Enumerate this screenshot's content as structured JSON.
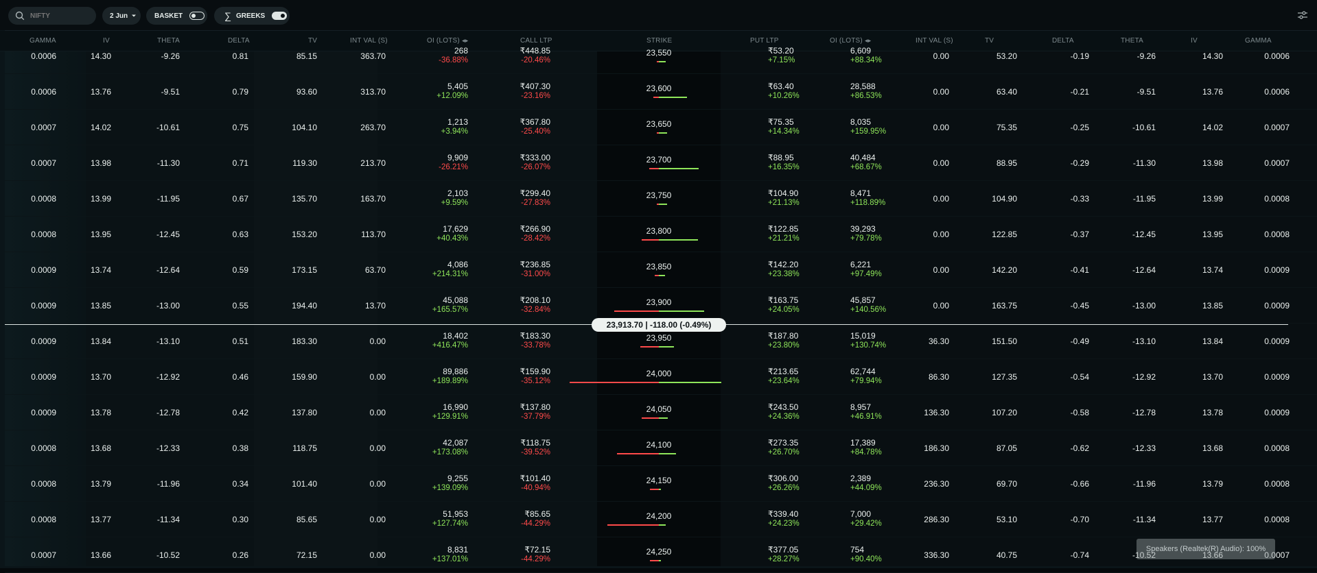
{
  "toolbar": {
    "search_placeholder": "NIFTY",
    "expiry": "2 Jun",
    "basket_label": "BASKET",
    "greeks_label": "GREEKS"
  },
  "headers": {
    "call": [
      "GAMMA",
      "IV",
      "THETA",
      "DELTA",
      "TV",
      "INT VAL (S)",
      "OI (LOTS)",
      "CALL LTP"
    ],
    "strike": "STRIKE",
    "put": [
      "PUT LTP",
      "OI (LOTS)",
      "INT VAL (S)",
      "TV",
      "DELTA",
      "THETA",
      "IV",
      "GAMMA"
    ]
  },
  "rows": [
    {
      "c_gamma": "0.0006",
      "c_iv": "14.30",
      "c_theta": "-9.26",
      "c_delta": "0.81",
      "c_tv": "85.15",
      "c_int": "363.70",
      "c_oi": "268",
      "c_oi_chg": "-36.88%",
      "c_ltp": "₹448.85",
      "c_ltp_chg": "-20.46%",
      "strike": "23,550",
      "p_ltp": "₹53.20",
      "p_ltp_chg": "+7.15%",
      "p_oi": "6,609",
      "p_oi_chg": "+88.34%",
      "p_int": "0.00",
      "p_tv": "53.20",
      "p_delta": "-0.19",
      "p_theta": "-9.26",
      "p_iv": "14.30",
      "p_gamma": "0.0006"
    },
    {
      "c_gamma": "0.0006",
      "c_iv": "13.76",
      "c_theta": "-9.51",
      "c_delta": "0.79",
      "c_tv": "93.60",
      "c_int": "313.70",
      "c_oi": "5,405",
      "c_oi_chg": "+12.09%",
      "c_ltp": "₹407.30",
      "c_ltp_chg": "-23.16%",
      "strike": "23,600",
      "p_ltp": "₹63.40",
      "p_ltp_chg": "+10.26%",
      "p_oi": "28,588",
      "p_oi_chg": "+86.53%",
      "p_int": "0.00",
      "p_tv": "63.40",
      "p_delta": "-0.21",
      "p_theta": "-9.51",
      "p_iv": "13.76",
      "p_gamma": "0.0006"
    },
    {
      "c_gamma": "0.0007",
      "c_iv": "14.02",
      "c_theta": "-10.61",
      "c_delta": "0.75",
      "c_tv": "104.10",
      "c_int": "263.70",
      "c_oi": "1,213",
      "c_oi_chg": "+3.94%",
      "c_ltp": "₹367.80",
      "c_ltp_chg": "-25.40%",
      "strike": "23,650",
      "p_ltp": "₹75.35",
      "p_ltp_chg": "+14.34%",
      "p_oi": "8,035",
      "p_oi_chg": "+159.95%",
      "p_int": "0.00",
      "p_tv": "75.35",
      "p_delta": "-0.25",
      "p_theta": "-10.61",
      "p_iv": "14.02",
      "p_gamma": "0.0007"
    },
    {
      "c_gamma": "0.0007",
      "c_iv": "13.98",
      "c_theta": "-11.30",
      "c_delta": "0.71",
      "c_tv": "119.30",
      "c_int": "213.70",
      "c_oi": "9,909",
      "c_oi_chg": "-26.21%",
      "c_ltp": "₹333.00",
      "c_ltp_chg": "-26.07%",
      "strike": "23,700",
      "p_ltp": "₹88.95",
      "p_ltp_chg": "+16.35%",
      "p_oi": "40,484",
      "p_oi_chg": "+68.67%",
      "p_int": "0.00",
      "p_tv": "88.95",
      "p_delta": "-0.29",
      "p_theta": "-11.30",
      "p_iv": "13.98",
      "p_gamma": "0.0007"
    },
    {
      "c_gamma": "0.0008",
      "c_iv": "13.99",
      "c_theta": "-11.95",
      "c_delta": "0.67",
      "c_tv": "135.70",
      "c_int": "163.70",
      "c_oi": "2,103",
      "c_oi_chg": "+9.59%",
      "c_ltp": "₹299.40",
      "c_ltp_chg": "-27.83%",
      "strike": "23,750",
      "p_ltp": "₹104.90",
      "p_ltp_chg": "+21.13%",
      "p_oi": "8,471",
      "p_oi_chg": "+118.89%",
      "p_int": "0.00",
      "p_tv": "104.90",
      "p_delta": "-0.33",
      "p_theta": "-11.95",
      "p_iv": "13.99",
      "p_gamma": "0.0008"
    },
    {
      "c_gamma": "0.0008",
      "c_iv": "13.95",
      "c_theta": "-12.45",
      "c_delta": "0.63",
      "c_tv": "153.20",
      "c_int": "113.70",
      "c_oi": "17,629",
      "c_oi_chg": "+40.43%",
      "c_ltp": "₹266.90",
      "c_ltp_chg": "-28.42%",
      "strike": "23,800",
      "p_ltp": "₹122.85",
      "p_ltp_chg": "+21.21%",
      "p_oi": "39,293",
      "p_oi_chg": "+79.78%",
      "p_int": "0.00",
      "p_tv": "122.85",
      "p_delta": "-0.37",
      "p_theta": "-12.45",
      "p_iv": "13.95",
      "p_gamma": "0.0008"
    },
    {
      "c_gamma": "0.0009",
      "c_iv": "13.74",
      "c_theta": "-12.64",
      "c_delta": "0.59",
      "c_tv": "173.15",
      "c_int": "63.70",
      "c_oi": "4,086",
      "c_oi_chg": "+214.31%",
      "c_ltp": "₹236.85",
      "c_ltp_chg": "-31.00%",
      "strike": "23,850",
      "p_ltp": "₹142.20",
      "p_ltp_chg": "+23.38%",
      "p_oi": "6,221",
      "p_oi_chg": "+97.49%",
      "p_int": "0.00",
      "p_tv": "142.20",
      "p_delta": "-0.41",
      "p_theta": "-12.64",
      "p_iv": "13.74",
      "p_gamma": "0.0009"
    },
    {
      "c_gamma": "0.0009",
      "c_iv": "13.85",
      "c_theta": "-13.00",
      "c_delta": "0.55",
      "c_tv": "194.40",
      "c_int": "13.70",
      "c_oi": "45,088",
      "c_oi_chg": "+165.57%",
      "c_ltp": "₹208.10",
      "c_ltp_chg": "-32.84%",
      "strike": "23,900",
      "p_ltp": "₹163.75",
      "p_ltp_chg": "+24.05%",
      "p_oi": "45,857",
      "p_oi_chg": "+140.56%",
      "p_int": "0.00",
      "p_tv": "163.75",
      "p_delta": "-0.45",
      "p_theta": "-13.00",
      "p_iv": "13.85",
      "p_gamma": "0.0009"
    },
    {
      "c_gamma": "0.0009",
      "c_iv": "13.84",
      "c_theta": "-13.10",
      "c_delta": "0.51",
      "c_tv": "183.30",
      "c_int": "0.00",
      "c_oi": "18,402",
      "c_oi_chg": "+416.47%",
      "c_ltp": "₹183.30",
      "c_ltp_chg": "-33.78%",
      "strike": "23,950",
      "p_ltp": "₹187.80",
      "p_ltp_chg": "+23.80%",
      "p_oi": "15,019",
      "p_oi_chg": "+130.74%",
      "p_int": "36.30",
      "p_tv": "151.50",
      "p_delta": "-0.49",
      "p_theta": "-13.10",
      "p_iv": "13.84",
      "p_gamma": "0.0009"
    },
    {
      "c_gamma": "0.0009",
      "c_iv": "13.70",
      "c_theta": "-12.92",
      "c_delta": "0.46",
      "c_tv": "159.90",
      "c_int": "0.00",
      "c_oi": "89,886",
      "c_oi_chg": "+189.89%",
      "c_ltp": "₹159.90",
      "c_ltp_chg": "-35.12%",
      "strike": "24,000",
      "p_ltp": "₹213.65",
      "p_ltp_chg": "+23.64%",
      "p_oi": "62,744",
      "p_oi_chg": "+79.94%",
      "p_int": "86.30",
      "p_tv": "127.35",
      "p_delta": "-0.54",
      "p_theta": "-12.92",
      "p_iv": "13.70",
      "p_gamma": "0.0009"
    },
    {
      "c_gamma": "0.0009",
      "c_iv": "13.78",
      "c_theta": "-12.78",
      "c_delta": "0.42",
      "c_tv": "137.80",
      "c_int": "0.00",
      "c_oi": "16,990",
      "c_oi_chg": "+129.91%",
      "c_ltp": "₹137.80",
      "c_ltp_chg": "-37.79%",
      "strike": "24,050",
      "p_ltp": "₹243.50",
      "p_ltp_chg": "+24.36%",
      "p_oi": "8,957",
      "p_oi_chg": "+46.91%",
      "p_int": "136.30",
      "p_tv": "107.20",
      "p_delta": "-0.58",
      "p_theta": "-12.78",
      "p_iv": "13.78",
      "p_gamma": "0.0009"
    },
    {
      "c_gamma": "0.0008",
      "c_iv": "13.68",
      "c_theta": "-12.33",
      "c_delta": "0.38",
      "c_tv": "118.75",
      "c_int": "0.00",
      "c_oi": "42,087",
      "c_oi_chg": "+173.08%",
      "c_ltp": "₹118.75",
      "c_ltp_chg": "-39.52%",
      "strike": "24,100",
      "p_ltp": "₹273.35",
      "p_ltp_chg": "+26.70%",
      "p_oi": "17,389",
      "p_oi_chg": "+84.78%",
      "p_int": "186.30",
      "p_tv": "87.05",
      "p_delta": "-0.62",
      "p_theta": "-12.33",
      "p_iv": "13.68",
      "p_gamma": "0.0008"
    },
    {
      "c_gamma": "0.0008",
      "c_iv": "13.79",
      "c_theta": "-11.96",
      "c_delta": "0.34",
      "c_tv": "101.40",
      "c_int": "0.00",
      "c_oi": "9,255",
      "c_oi_chg": "+139.09%",
      "c_ltp": "₹101.40",
      "c_ltp_chg": "-40.94%",
      "strike": "24,150",
      "p_ltp": "₹306.00",
      "p_ltp_chg": "+26.26%",
      "p_oi": "2,389",
      "p_oi_chg": "+44.09%",
      "p_int": "236.30",
      "p_tv": "69.70",
      "p_delta": "-0.66",
      "p_theta": "-11.96",
      "p_iv": "13.79",
      "p_gamma": "0.0008"
    },
    {
      "c_gamma": "0.0008",
      "c_iv": "13.77",
      "c_theta": "-11.34",
      "c_delta": "0.30",
      "c_tv": "85.65",
      "c_int": "0.00",
      "c_oi": "51,953",
      "c_oi_chg": "+127.74%",
      "c_ltp": "₹85.65",
      "c_ltp_chg": "-44.29%",
      "strike": "24,200",
      "p_ltp": "₹339.40",
      "p_ltp_chg": "+24.23%",
      "p_oi": "7,000",
      "p_oi_chg": "+29.42%",
      "p_int": "286.30",
      "p_tv": "53.10",
      "p_delta": "-0.70",
      "p_theta": "-11.34",
      "p_iv": "13.77",
      "p_gamma": "0.0008"
    },
    {
      "c_gamma": "0.0007",
      "c_iv": "13.66",
      "c_theta": "-10.52",
      "c_delta": "0.26",
      "c_tv": "72.15",
      "c_int": "0.00",
      "c_oi": "8,831",
      "c_oi_chg": "+137.01%",
      "c_ltp": "₹72.15",
      "c_ltp_chg": "-44.29%",
      "strike": "24,250",
      "p_ltp": "₹377.05",
      "p_ltp_chg": "+28.27%",
      "p_oi": "754",
      "p_oi_chg": "+90.40%",
      "p_int": "336.30",
      "p_tv": "40.75",
      "p_delta": "-0.74",
      "p_theta": "-10.52",
      "p_iv": "13.66",
      "p_gamma": "0.0007"
    }
  ],
  "spot": {
    "label": "23,913.70 | -118.00 (-0.49%)"
  },
  "toast": {
    "text": "Speakers (Realtek(R) Audio): 100%"
  },
  "oi_bars": {
    "call_oi_lots": [
      268,
      5405,
      1213,
      9909,
      2103,
      17629,
      4086,
      45088,
      18402,
      89886,
      16990,
      42087,
      9255,
      51953,
      8831
    ],
    "put_oi_lots": [
      6609,
      28588,
      8035,
      40484,
      8471,
      39293,
      6221,
      45857,
      15019,
      62744,
      8957,
      17389,
      2389,
      7000,
      754
    ]
  },
  "colors": {
    "positive": "#8fe65a",
    "negative": "#ff4a4a",
    "bar_call": "#ff4a4a",
    "bar_put": "#8fe65a",
    "spot_pill": "#eef2f0"
  }
}
